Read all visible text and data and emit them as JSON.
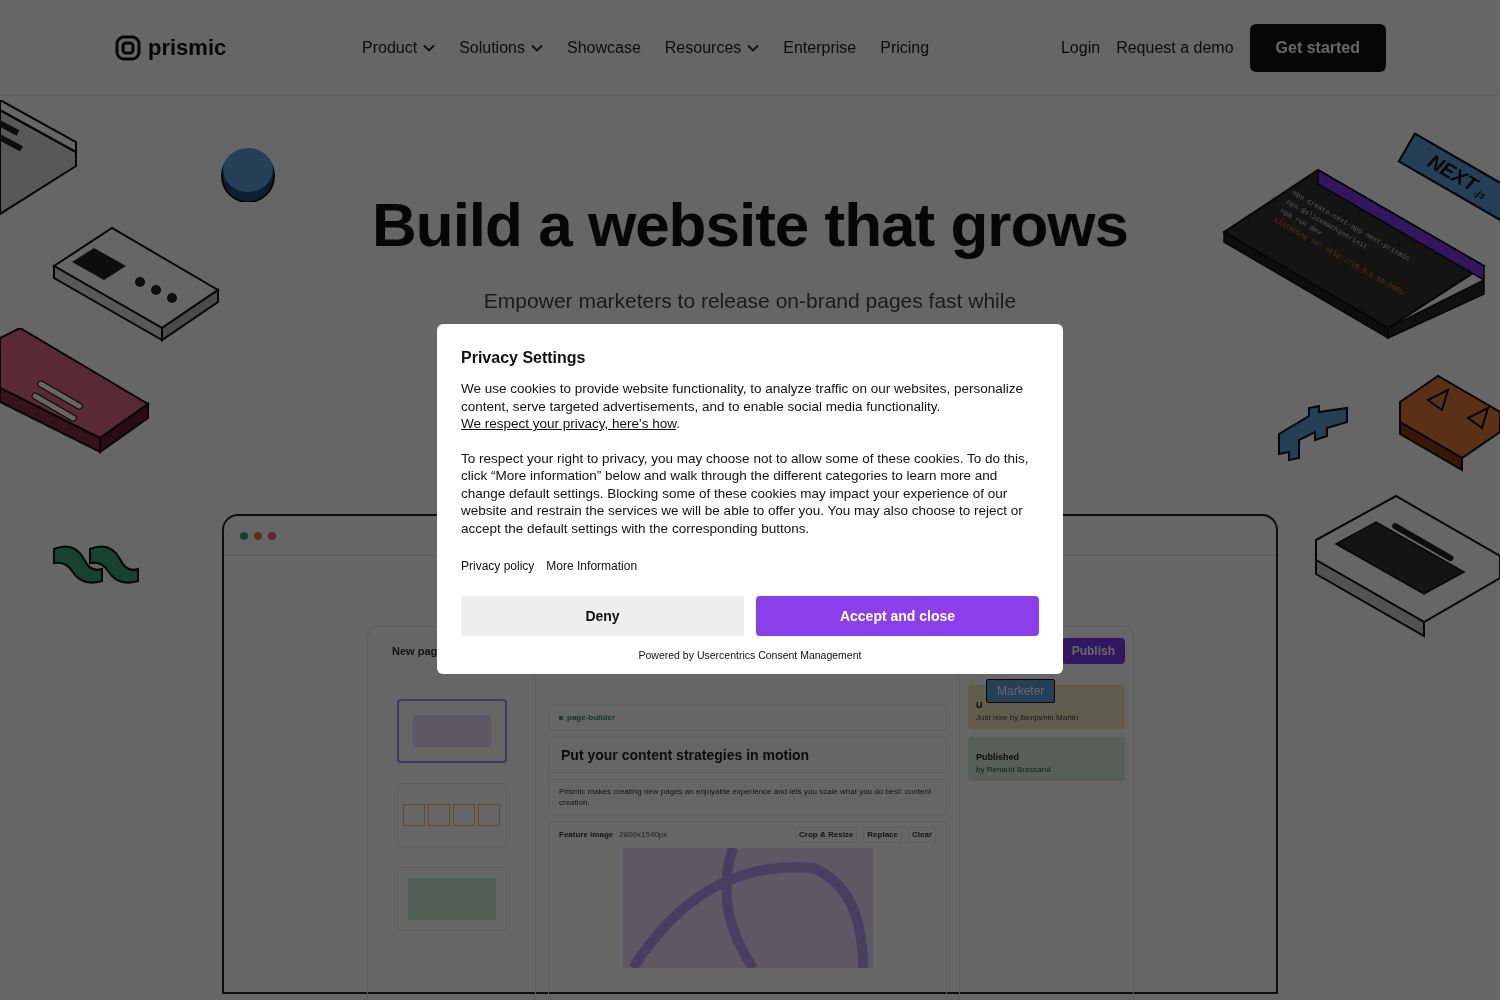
{
  "nav": {
    "logo": "prismic",
    "items": [
      {
        "label": "Product",
        "dropdown": true
      },
      {
        "label": "Solutions",
        "dropdown": true
      },
      {
        "label": "Showcase",
        "dropdown": false
      },
      {
        "label": "Resources",
        "dropdown": true
      },
      {
        "label": "Enterprise",
        "dropdown": false
      },
      {
        "label": "Pricing",
        "dropdown": false
      }
    ],
    "login": "Login",
    "demo": "Request a demo",
    "cta": "Get started"
  },
  "hero": {
    "title": "Build a website that grows",
    "subtitle": "Empower marketers to release on-brand pages fast while"
  },
  "illustrations": {
    "terminal_lines": [
      {
        "kind": "command",
        "text": "npx create-next-app next-prismic"
      },
      {
        "kind": "command",
        "text": "npx @slicemachine/init"
      },
      {
        "kind": "command",
        "text": "npm run dev"
      },
      {
        "kind": "output",
        "text": "Listening on: http://10.0.0.10:3000/"
      }
    ],
    "framework_badge": {
      "name": "NEXT",
      "suffix": ".js"
    }
  },
  "editor_mock": {
    "page_title": "New pag",
    "publish": "Publish",
    "cursor_label": "Marketer",
    "statuses": [
      {
        "title": "U",
        "detail": "Just now by Benjamin Martin",
        "kind": "draft"
      },
      {
        "title": "Published",
        "detail": "by Renaud Bressand",
        "kind": "published"
      }
    ],
    "tag": "page-builder",
    "heading": "Put your content strategies in motion",
    "description": "Prismic makes creating new pages an enjoyable experience and lets you scale what you do best: content creation.",
    "image_field": {
      "label": "Feature image",
      "size": "2800x1540px",
      "actions": [
        "Crop & Resize",
        "Replace",
        "Clear"
      ]
    }
  },
  "consent": {
    "title": "Privacy Settings",
    "paragraph_1": "We use cookies to provide website functionality, to analyze traffic on our websites, personalize content, serve targeted advertisements, and to enable social media functionality.",
    "paragraph_1_link": "We respect your privacy, here's how",
    "paragraph_1_end": ".",
    "paragraph_2": "To respect your right to privacy, you may choose not to allow some of these cookies. To do this, click “More information” below and walk through the different categories to learn more and change default settings. Blocking some of these cookies may impact your experience of our website and restrain the services we will be able to offer you. You may also choose to reject or accept the default settings with the corresponding buttons.",
    "links": [
      "Privacy policy",
      "More Information"
    ],
    "deny": "Deny",
    "accept": "Accept and close",
    "powered_by": "Powered by Usercentrics Consent Management"
  }
}
